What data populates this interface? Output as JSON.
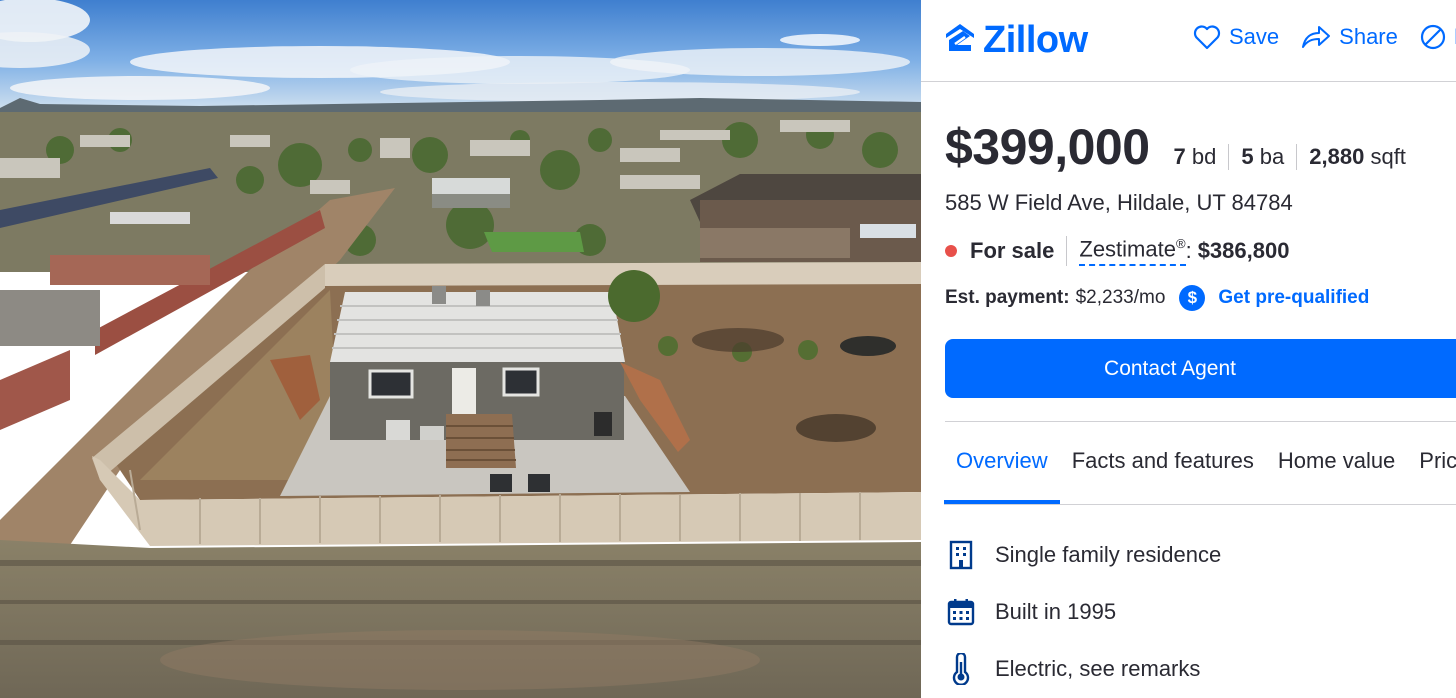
{
  "header": {
    "logo_text": "Zillow",
    "actions": [
      {
        "label": "Save",
        "icon": "heart-icon"
      },
      {
        "label": "Share",
        "icon": "share-icon"
      },
      {
        "label": "H",
        "icon": "hide-icon"
      }
    ]
  },
  "listing": {
    "price": "$399,000",
    "beds_value": "7",
    "beds_unit": "bd",
    "baths_value": "5",
    "baths_unit": "ba",
    "sqft_value": "2,880",
    "sqft_unit": "sqft",
    "address": "585 W Field Ave, Hildale, UT 84784",
    "status": "For sale",
    "zestimate_label": "Zestimate",
    "zestimate_mark": "®",
    "zestimate_colon": ":",
    "zestimate_value": "$386,800",
    "payment_label": "Est. payment:",
    "payment_value": "$2,233/mo",
    "payment_badge": "$",
    "prequal_label": "Get pre-qualified",
    "contact_label": "Contact Agent"
  },
  "tabs": [
    {
      "label": "Overview",
      "active": true
    },
    {
      "label": "Facts and features",
      "active": false
    },
    {
      "label": "Home value",
      "active": false
    },
    {
      "label": "Pric",
      "active": false
    }
  ],
  "features": [
    {
      "label": "Single family residence",
      "icon": "building-icon"
    },
    {
      "label": "Built in 1995",
      "icon": "calendar-icon"
    },
    {
      "label": "Electric, see remarks",
      "icon": "thermometer-icon"
    }
  ],
  "colors": {
    "brand_blue": "#006aff",
    "status_red": "#e8504a",
    "text": "#2a2a33"
  }
}
